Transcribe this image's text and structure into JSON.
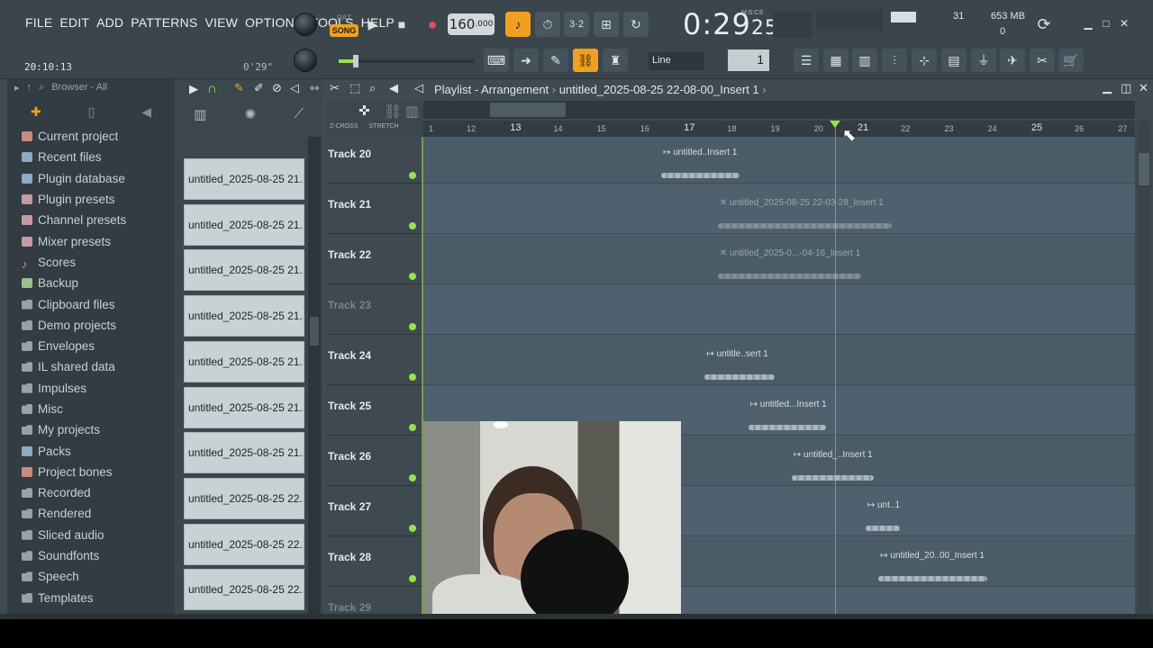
{
  "menu": [
    "FILE",
    "EDIT",
    "ADD",
    "PATTERNS",
    "VIEW",
    "OPTIONS",
    "TOOLS",
    "HELP"
  ],
  "transport": {
    "pat_label": "PAT",
    "song_label": "SONG",
    "tempo_int": "160",
    "tempo_dec": ".000",
    "time_main": "0:29",
    "time_ms": "25",
    "time_unit_label": "M:S:CS"
  },
  "hint": {
    "clock": "20:10:13",
    "length": "0'29\""
  },
  "cpu": {
    "polyphony": "31",
    "memory": "653 MB",
    "value2": "0"
  },
  "snap": {
    "mode": "Line",
    "step": "1"
  },
  "browser": {
    "label": "Browser - All",
    "items": [
      {
        "label": "Current project",
        "icon": "red"
      },
      {
        "label": "Recent files",
        "icon": "blue"
      },
      {
        "label": "Plugin database",
        "icon": "blue"
      },
      {
        "label": "Plugin presets",
        "icon": "pink"
      },
      {
        "label": "Channel presets",
        "icon": "pink"
      },
      {
        "label": "Mixer presets",
        "icon": "pink"
      },
      {
        "label": "Scores",
        "icon": "note"
      },
      {
        "label": "Backup",
        "icon": "green"
      },
      {
        "label": "Clipboard files",
        "icon": "folder"
      },
      {
        "label": "Demo projects",
        "icon": "folder"
      },
      {
        "label": "Envelopes",
        "icon": "folder"
      },
      {
        "label": "IL shared data",
        "icon": "folder"
      },
      {
        "label": "Impulses",
        "icon": "folder"
      },
      {
        "label": "Misc",
        "icon": "folder"
      },
      {
        "label": "My projects",
        "icon": "folder"
      },
      {
        "label": "Packs",
        "icon": "blue"
      },
      {
        "label": "Project bones",
        "icon": "red"
      },
      {
        "label": "Recorded",
        "icon": "folder"
      },
      {
        "label": "Rendered",
        "icon": "folder"
      },
      {
        "label": "Sliced audio",
        "icon": "folder"
      },
      {
        "label": "Soundfonts",
        "icon": "folder"
      },
      {
        "label": "Speech",
        "icon": "folder"
      },
      {
        "label": "Templates",
        "icon": "folder"
      }
    ]
  },
  "channels": [
    "untitled_2025-08-25 21...",
    "untitled_2025-08-25 21...",
    "untitled_2025-08-25 21...",
    "untitled_2025-08-25 21...",
    "untitled_2025-08-25 21...",
    "untitled_2025-08-25 21...",
    "untitled_2025-08-25 21...",
    "untitled_2025-08-25 22...",
    "untitled_2025-08-25 22...",
    "untitled_2025-08-25 22..."
  ],
  "playlist": {
    "title": "Playlist - Arrangement",
    "separator": "›",
    "project": "untitled_2025-08-25 22-08-00_Insert 1",
    "zcross": "Z-CROSS",
    "stretch": "STRETCH",
    "ruler": [
      "1",
      "12",
      "13",
      "14",
      "15",
      "16",
      "17",
      "18",
      "19",
      "20",
      "21",
      "22",
      "23",
      "24",
      "25",
      "26",
      "27"
    ],
    "tracks": [
      {
        "name": "Track 20",
        "dim": false,
        "clip": {
          "label": "untitled..Insert 1",
          "start": 16.4,
          "end": 18.2,
          "muted": false
        }
      },
      {
        "name": "Track 21",
        "dim": false,
        "clip": {
          "label": "untitled_2025-08-25 22-03-28_Insert 1",
          "start": 17.7,
          "end": 21.7,
          "muted": true
        }
      },
      {
        "name": "Track 22",
        "dim": false,
        "clip": {
          "label": "untitled_2025-0...-04-16_Insert 1",
          "start": 17.7,
          "end": 21.0,
          "muted": true
        }
      },
      {
        "name": "Track 23",
        "dim": true,
        "clip": null
      },
      {
        "name": "Track 24",
        "dim": false,
        "clip": {
          "label": "untitle..sert 1",
          "start": 17.4,
          "end": 19.0,
          "muted": false
        }
      },
      {
        "name": "Track 25",
        "dim": false,
        "clip": {
          "label": "untitled...Insert 1",
          "start": 18.4,
          "end": 20.2,
          "muted": false
        }
      },
      {
        "name": "Track 26",
        "dim": false,
        "clip": {
          "label": "untitled_..Insert 1",
          "start": 19.4,
          "end": 21.3,
          "muted": false
        }
      },
      {
        "name": "Track 27",
        "dim": false,
        "clip": {
          "label": "unt..1",
          "start": 21.1,
          "end": 21.9,
          "muted": false
        }
      },
      {
        "name": "Track 28",
        "dim": false,
        "clip": {
          "label": "untitled_20..00_Insert 1",
          "start": 21.4,
          "end": 23.9,
          "muted": false
        }
      },
      {
        "name": "Track 29",
        "dim": true,
        "clip": null
      }
    ],
    "playhead_bar": 20.4
  }
}
